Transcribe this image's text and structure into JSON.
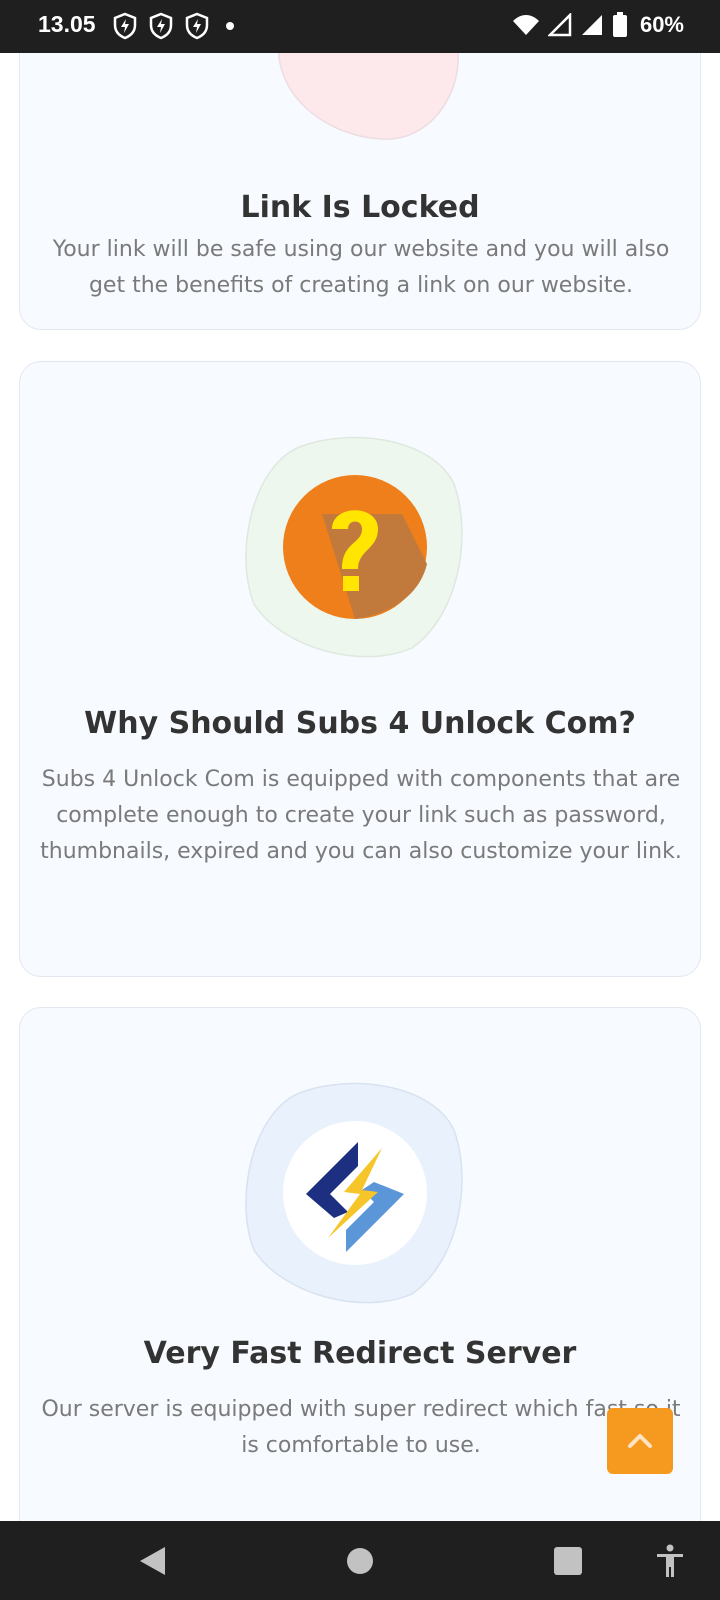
{
  "status_bar": {
    "time": "13.05",
    "battery": "60%",
    "icons": [
      "shield-icon",
      "shield-icon",
      "shield-icon",
      "notification-dot-icon",
      "wifi-icon",
      "signal-icon",
      "signal-icon",
      "battery-icon"
    ]
  },
  "cards": [
    {
      "title": "Link Is Locked",
      "description": "Your link will be safe using our website and you will also get the benefits of creating a link on our website.",
      "blob_color": "#fde8ec"
    },
    {
      "title": "Why Should Subs 4 Unlock Com?",
      "description": "Subs 4 Unlock Com is equipped with components that are complete enough to create your link such as password, thumbnails, expired and you can also customize your link.",
      "icon": "question-mark-icon",
      "blob_color": "#eef7ee",
      "icon_colors": {
        "circle": "#ef7f1a",
        "shadow": "#c27a3c",
        "mark": "#ffe500"
      }
    },
    {
      "title": "Very Fast Redirect Server",
      "description": "Our server is equipped with super redirect which fast so it is comfortable to use.",
      "icon": "lightning-bolt-logo-icon",
      "blob_color": "#e8f1fc",
      "icon_colors": {
        "dark": "#1d2f80",
        "light": "#5b96d8",
        "bolt": "#f5c52a"
      }
    }
  ],
  "scroll_top": {
    "icon": "chevron-up-icon",
    "color": "#f59a1f"
  },
  "nav_bar": {
    "icons": [
      "back-icon",
      "home-icon",
      "recents-icon",
      "accessibility-icon"
    ]
  }
}
